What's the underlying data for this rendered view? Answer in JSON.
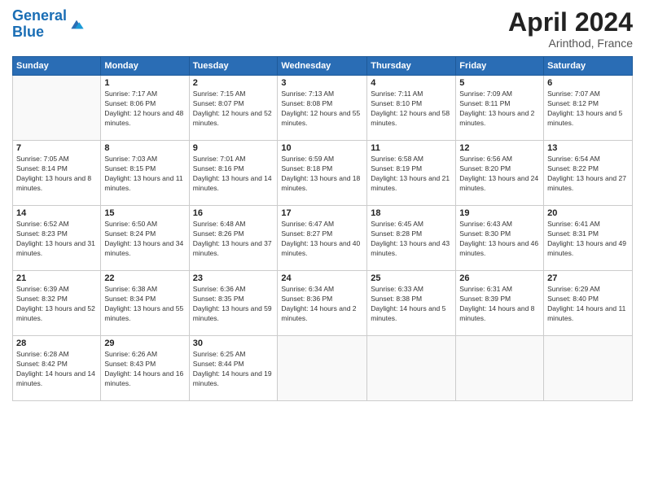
{
  "logo": {
    "line1": "General",
    "line2": "Blue"
  },
  "title": {
    "month_year": "April 2024",
    "location": "Arinthod, France"
  },
  "days_of_week": [
    "Sunday",
    "Monday",
    "Tuesday",
    "Wednesday",
    "Thursday",
    "Friday",
    "Saturday"
  ],
  "weeks": [
    [
      {
        "day": "",
        "sunrise": "",
        "sunset": "",
        "daylight": ""
      },
      {
        "day": "1",
        "sunrise": "Sunrise: 7:17 AM",
        "sunset": "Sunset: 8:06 PM",
        "daylight": "Daylight: 12 hours and 48 minutes."
      },
      {
        "day": "2",
        "sunrise": "Sunrise: 7:15 AM",
        "sunset": "Sunset: 8:07 PM",
        "daylight": "Daylight: 12 hours and 52 minutes."
      },
      {
        "day": "3",
        "sunrise": "Sunrise: 7:13 AM",
        "sunset": "Sunset: 8:08 PM",
        "daylight": "Daylight: 12 hours and 55 minutes."
      },
      {
        "day": "4",
        "sunrise": "Sunrise: 7:11 AM",
        "sunset": "Sunset: 8:10 PM",
        "daylight": "Daylight: 12 hours and 58 minutes."
      },
      {
        "day": "5",
        "sunrise": "Sunrise: 7:09 AM",
        "sunset": "Sunset: 8:11 PM",
        "daylight": "Daylight: 13 hours and 2 minutes."
      },
      {
        "day": "6",
        "sunrise": "Sunrise: 7:07 AM",
        "sunset": "Sunset: 8:12 PM",
        "daylight": "Daylight: 13 hours and 5 minutes."
      }
    ],
    [
      {
        "day": "7",
        "sunrise": "Sunrise: 7:05 AM",
        "sunset": "Sunset: 8:14 PM",
        "daylight": "Daylight: 13 hours and 8 minutes."
      },
      {
        "day": "8",
        "sunrise": "Sunrise: 7:03 AM",
        "sunset": "Sunset: 8:15 PM",
        "daylight": "Daylight: 13 hours and 11 minutes."
      },
      {
        "day": "9",
        "sunrise": "Sunrise: 7:01 AM",
        "sunset": "Sunset: 8:16 PM",
        "daylight": "Daylight: 13 hours and 14 minutes."
      },
      {
        "day": "10",
        "sunrise": "Sunrise: 6:59 AM",
        "sunset": "Sunset: 8:18 PM",
        "daylight": "Daylight: 13 hours and 18 minutes."
      },
      {
        "day": "11",
        "sunrise": "Sunrise: 6:58 AM",
        "sunset": "Sunset: 8:19 PM",
        "daylight": "Daylight: 13 hours and 21 minutes."
      },
      {
        "day": "12",
        "sunrise": "Sunrise: 6:56 AM",
        "sunset": "Sunset: 8:20 PM",
        "daylight": "Daylight: 13 hours and 24 minutes."
      },
      {
        "day": "13",
        "sunrise": "Sunrise: 6:54 AM",
        "sunset": "Sunset: 8:22 PM",
        "daylight": "Daylight: 13 hours and 27 minutes."
      }
    ],
    [
      {
        "day": "14",
        "sunrise": "Sunrise: 6:52 AM",
        "sunset": "Sunset: 8:23 PM",
        "daylight": "Daylight: 13 hours and 31 minutes."
      },
      {
        "day": "15",
        "sunrise": "Sunrise: 6:50 AM",
        "sunset": "Sunset: 8:24 PM",
        "daylight": "Daylight: 13 hours and 34 minutes."
      },
      {
        "day": "16",
        "sunrise": "Sunrise: 6:48 AM",
        "sunset": "Sunset: 8:26 PM",
        "daylight": "Daylight: 13 hours and 37 minutes."
      },
      {
        "day": "17",
        "sunrise": "Sunrise: 6:47 AM",
        "sunset": "Sunset: 8:27 PM",
        "daylight": "Daylight: 13 hours and 40 minutes."
      },
      {
        "day": "18",
        "sunrise": "Sunrise: 6:45 AM",
        "sunset": "Sunset: 8:28 PM",
        "daylight": "Daylight: 13 hours and 43 minutes."
      },
      {
        "day": "19",
        "sunrise": "Sunrise: 6:43 AM",
        "sunset": "Sunset: 8:30 PM",
        "daylight": "Daylight: 13 hours and 46 minutes."
      },
      {
        "day": "20",
        "sunrise": "Sunrise: 6:41 AM",
        "sunset": "Sunset: 8:31 PM",
        "daylight": "Daylight: 13 hours and 49 minutes."
      }
    ],
    [
      {
        "day": "21",
        "sunrise": "Sunrise: 6:39 AM",
        "sunset": "Sunset: 8:32 PM",
        "daylight": "Daylight: 13 hours and 52 minutes."
      },
      {
        "day": "22",
        "sunrise": "Sunrise: 6:38 AM",
        "sunset": "Sunset: 8:34 PM",
        "daylight": "Daylight: 13 hours and 55 minutes."
      },
      {
        "day": "23",
        "sunrise": "Sunrise: 6:36 AM",
        "sunset": "Sunset: 8:35 PM",
        "daylight": "Daylight: 13 hours and 59 minutes."
      },
      {
        "day": "24",
        "sunrise": "Sunrise: 6:34 AM",
        "sunset": "Sunset: 8:36 PM",
        "daylight": "Daylight: 14 hours and 2 minutes."
      },
      {
        "day": "25",
        "sunrise": "Sunrise: 6:33 AM",
        "sunset": "Sunset: 8:38 PM",
        "daylight": "Daylight: 14 hours and 5 minutes."
      },
      {
        "day": "26",
        "sunrise": "Sunrise: 6:31 AM",
        "sunset": "Sunset: 8:39 PM",
        "daylight": "Daylight: 14 hours and 8 minutes."
      },
      {
        "day": "27",
        "sunrise": "Sunrise: 6:29 AM",
        "sunset": "Sunset: 8:40 PM",
        "daylight": "Daylight: 14 hours and 11 minutes."
      }
    ],
    [
      {
        "day": "28",
        "sunrise": "Sunrise: 6:28 AM",
        "sunset": "Sunset: 8:42 PM",
        "daylight": "Daylight: 14 hours and 14 minutes."
      },
      {
        "day": "29",
        "sunrise": "Sunrise: 6:26 AM",
        "sunset": "Sunset: 8:43 PM",
        "daylight": "Daylight: 14 hours and 16 minutes."
      },
      {
        "day": "30",
        "sunrise": "Sunrise: 6:25 AM",
        "sunset": "Sunset: 8:44 PM",
        "daylight": "Daylight: 14 hours and 19 minutes."
      },
      {
        "day": "",
        "sunrise": "",
        "sunset": "",
        "daylight": ""
      },
      {
        "day": "",
        "sunrise": "",
        "sunset": "",
        "daylight": ""
      },
      {
        "day": "",
        "sunrise": "",
        "sunset": "",
        "daylight": ""
      },
      {
        "day": "",
        "sunrise": "",
        "sunset": "",
        "daylight": ""
      }
    ]
  ]
}
